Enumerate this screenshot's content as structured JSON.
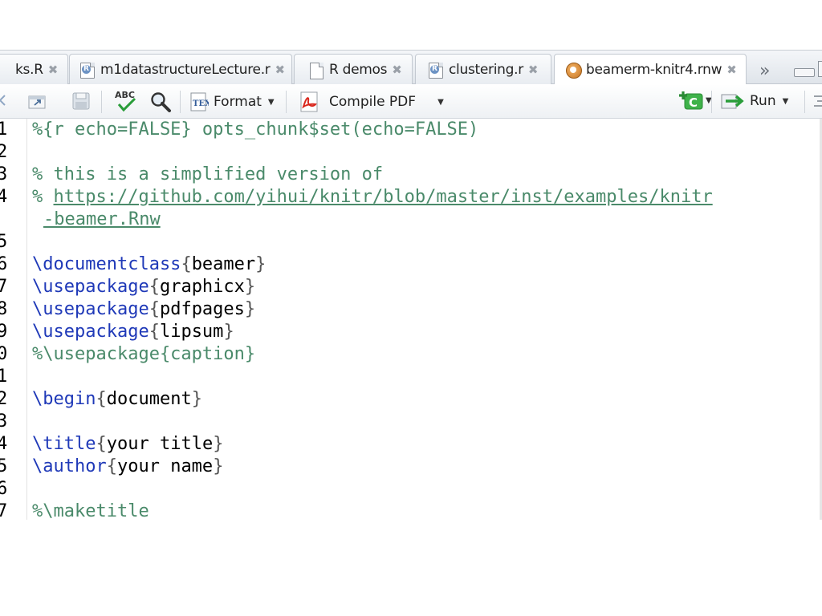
{
  "tabs": [
    {
      "label": "ks.R",
      "icon": "r-script-icon"
    },
    {
      "label": "m1datastructureLecture.r",
      "icon": "r-script-icon"
    },
    {
      "label": "R demos",
      "icon": "document-icon"
    },
    {
      "label": "clustering.r",
      "icon": "r-script-icon"
    },
    {
      "label": "beamerm-knitr4.rnw",
      "icon": "rnw-file-icon",
      "active": true
    }
  ],
  "tab_close_glyph": "✖",
  "overflow_glyph": "»",
  "toolbar": {
    "format_label": "Format",
    "compile_label": "Compile PDF",
    "run_label": "Run",
    "insert_chunk_glyph": "C"
  },
  "editor": {
    "line_numbers": [
      "1",
      "2",
      "3",
      "4",
      "",
      "5",
      "6",
      "7",
      "8",
      "9",
      "0",
      "1",
      "2",
      "3",
      "4",
      "5",
      "6",
      "7"
    ],
    "lines": {
      "l1": "%{r echo=FALSE} opts_chunk$set(echo=FALSE)",
      "l3": "% this is a simplified version of",
      "l4_prefix": "% ",
      "l4_url": "https://github.com/yihui/knitr/blob/master/inst/examples/knitr",
      "l4_wrap": "-beamer.Rnw",
      "l6_cmd": "\\documentclass",
      "l6_arg": "beamer",
      "l7_cmd": "\\usepackage",
      "l7_arg": "graphicx",
      "l8_cmd": "\\usepackage",
      "l8_arg": "pdfpages",
      "l9_cmd": "\\usepackage",
      "l9_arg": "lipsum",
      "l10": "%\\usepackage{caption}",
      "l12_cmd": "\\begin",
      "l12_arg": "document",
      "l14_cmd": "\\title",
      "l14_arg": "your title",
      "l15_cmd": "\\author",
      "l15_arg": "your name",
      "l17": "%\\maketitle"
    }
  },
  "colors": {
    "comment": "#4a8a6a",
    "keyword": "#1f39b8"
  }
}
